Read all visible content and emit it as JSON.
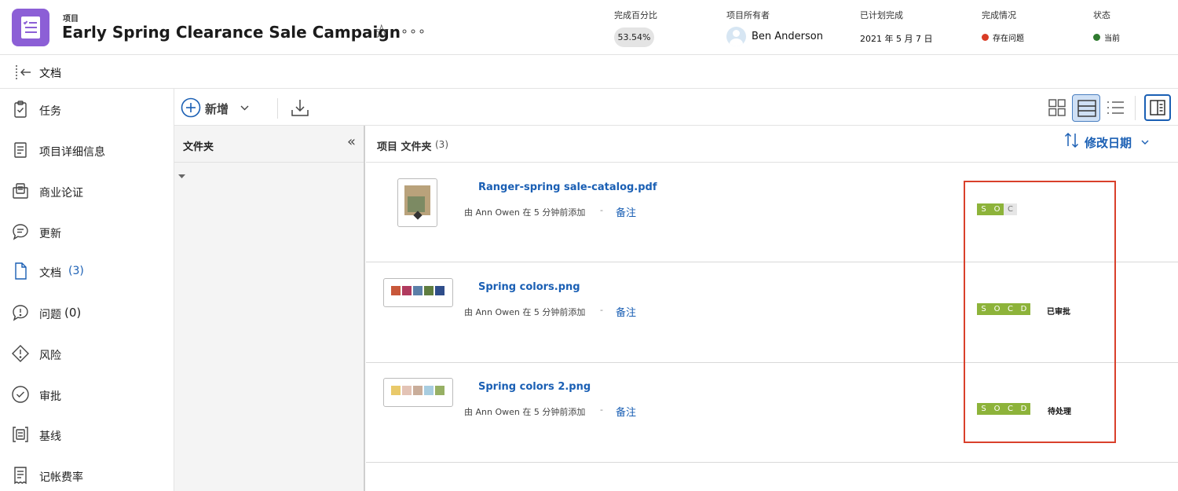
{
  "header": {
    "kicker": "项目",
    "title": "Early Spring Clearance Sale Campaign",
    "percent_label": "完成百分比",
    "percent_value": "53.54%",
    "owner_label": "项目所有者",
    "owner_name": "Ben Anderson",
    "planned_label": "已计划完成",
    "planned_value": "2021 年 5 月 7 日",
    "condition_label": "完成情况",
    "condition_value": "存在问题",
    "condition_color": "#d93c25",
    "status_label": "状态",
    "status_value": "当前",
    "status_color": "#2f7a2f"
  },
  "docbar": {
    "title": "文档"
  },
  "nav": {
    "items": [
      {
        "label": "任务",
        "icon": "clipboard-check-icon"
      },
      {
        "label": "项目详细信息",
        "icon": "document-lines-icon"
      },
      {
        "label": "商业论证",
        "icon": "briefcase-doc-icon"
      },
      {
        "label": "更新",
        "icon": "chat-bubble-icon"
      },
      {
        "label": "文档",
        "count": "(3)",
        "icon": "file-icon"
      },
      {
        "label": "问题",
        "count": "(0)",
        "icon": "issue-bubble-icon"
      },
      {
        "label": "风险",
        "icon": "risk-diamond-icon"
      },
      {
        "label": "审批",
        "icon": "check-circle-icon"
      },
      {
        "label": "基线",
        "icon": "baseline-icon"
      },
      {
        "label": "记帐费率",
        "icon": "receipt-icon"
      }
    ]
  },
  "toolbar": {
    "new_label": "新增"
  },
  "folders": {
    "title": "文件夹"
  },
  "list": {
    "title": "项目 文件夹",
    "count": "(3)",
    "sort_label": "修改日期",
    "files": [
      {
        "name": "Ranger-spring sale-catalog.pdf",
        "meta": "由 Ann Owen 在 5 分钟前添加",
        "separator": "-",
        "note": "备注",
        "flags": [
          "S",
          "O",
          "C"
        ],
        "status": ""
      },
      {
        "name": "Spring colors.png",
        "meta": "由 Ann Owen 在 5 分钟前添加",
        "separator": "-",
        "note": "备注",
        "flags": [
          "S",
          "O",
          "C",
          "D"
        ],
        "status": "已审批",
        "swatches": [
          "#c8573a",
          "#b03a5e",
          "#5b7fa8",
          "#5f7d3f",
          "#2f4d8a"
        ]
      },
      {
        "name": "Spring colors 2.png",
        "meta": "由 Ann Owen 在 5 分钟前添加",
        "separator": "-",
        "note": "备注",
        "flags": [
          "S",
          "O",
          "C",
          "D"
        ],
        "status": "待处理",
        "swatches": [
          "#e9c96a",
          "#e3c3b5",
          "#c9ad9a",
          "#a8cde0",
          "#97b064"
        ]
      }
    ]
  },
  "colors": {
    "accent": "#1a5fb4",
    "flag_green": "#8db33a",
    "highlight_box": "#d9402b"
  }
}
